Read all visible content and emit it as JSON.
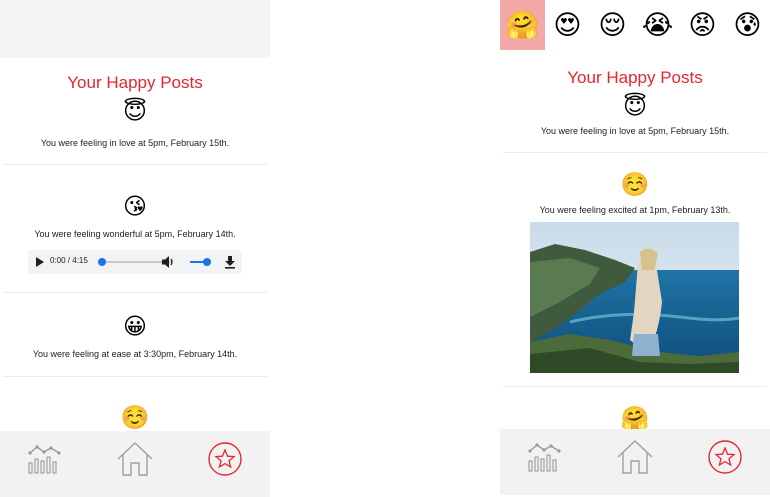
{
  "left_screen": {
    "title": "Your Happy Posts",
    "posts": [
      {
        "emoji": "😇",
        "emoji_name": "smiling-face-with-halo",
        "text": "You were feeling in love at 5pm, February 15th."
      },
      {
        "emoji": "😘",
        "emoji_name": "face-blowing-kiss",
        "text": "You were feeling wonderful at 5pm, February 14th."
      },
      {
        "emoji": "😀",
        "emoji_name": "grinning-face",
        "text": "You were feeling at ease at 3:30pm, February 14th."
      },
      {
        "emoji": "☺️",
        "emoji_name": "smiling-face",
        "text": ""
      }
    ],
    "audio": {
      "time": "0:00 / 4:15",
      "progress": 0.0,
      "volume": 0.8
    }
  },
  "right_screen": {
    "emoji_bar": [
      {
        "emoji": "🤗",
        "name": "hugging-face",
        "selected": true
      },
      {
        "emoji": "😍",
        "name": "heart-eyes-face",
        "selected": false
      },
      {
        "emoji": "😌",
        "name": "relieved-face",
        "selected": false
      },
      {
        "emoji": "😭",
        "name": "loudly-crying-face",
        "selected": false
      },
      {
        "emoji": "😡",
        "name": "pouting-face",
        "selected": false
      },
      {
        "emoji": "😰",
        "name": "anxious-face-with-sweat",
        "selected": false
      }
    ],
    "title": "Your Happy Posts",
    "posts": [
      {
        "emoji": "😇",
        "emoji_name": "smiling-face-with-halo",
        "text": "You were feeling in love at 5pm, February 15th."
      },
      {
        "emoji": "☺️",
        "emoji_name": "smiling-face",
        "text": "You were feeling excited at 1pm, February 13th."
      },
      {
        "emoji": "🤗",
        "emoji_name": "hugging-face",
        "text": ""
      }
    ]
  },
  "bottom_nav": [
    {
      "icon": "stats-chart-icon"
    },
    {
      "icon": "home-icon"
    },
    {
      "icon": "star-icon",
      "active": true
    }
  ],
  "colors": {
    "accent": "#e8242e",
    "selected_emoji_bg": "#f4a7a7",
    "nav_bg": "#f2f2f2",
    "audio_blue": "#1a73e8"
  }
}
